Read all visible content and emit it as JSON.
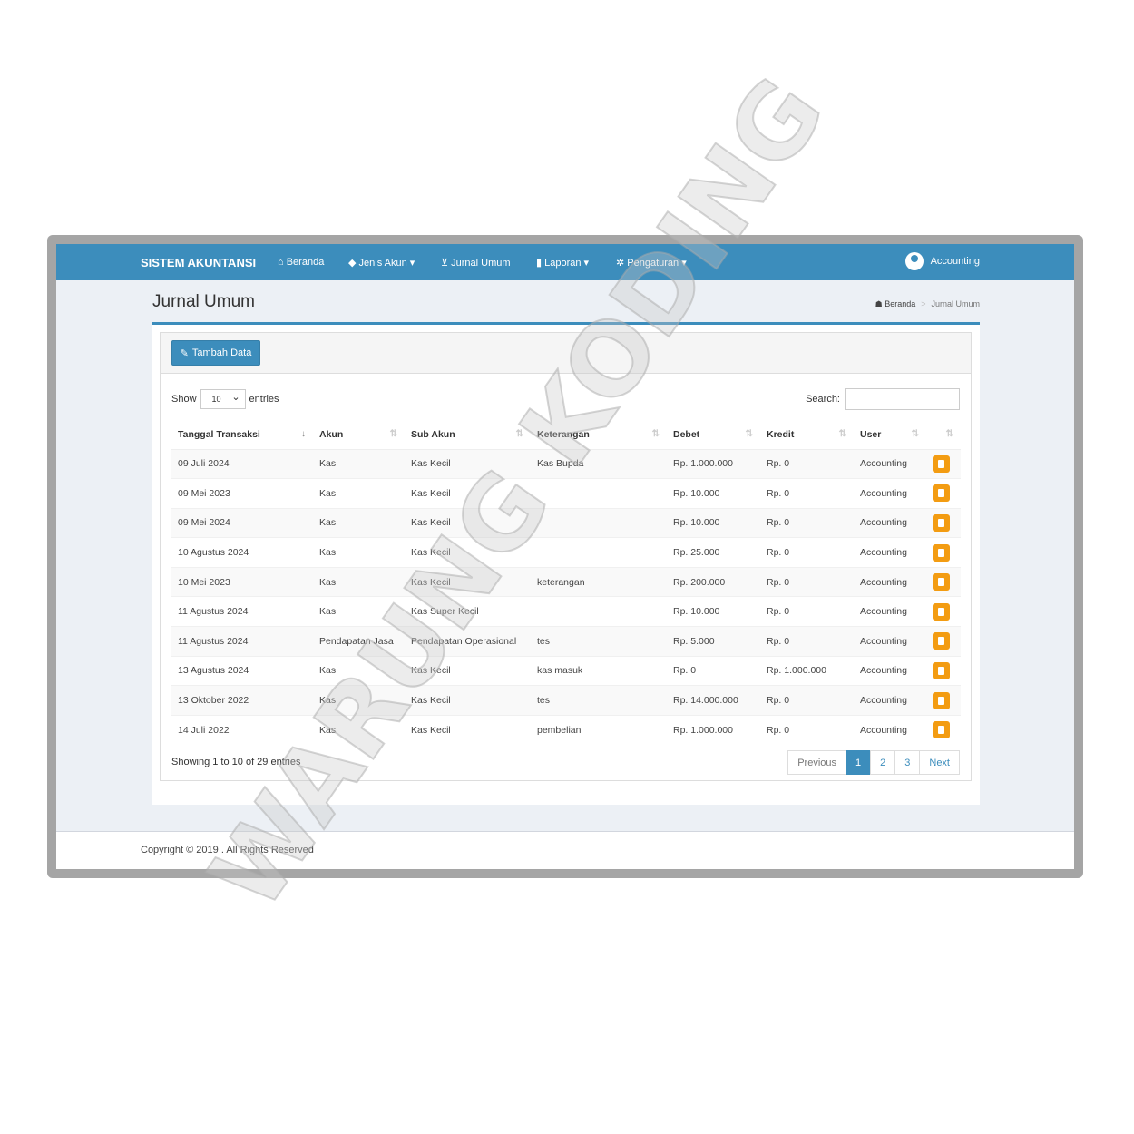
{
  "navbar": {
    "brand": "SISTEM AKUNTANSI",
    "items": [
      {
        "label": "Beranda",
        "icon": "home-icon"
      },
      {
        "label": "Jenis Akun ▾",
        "icon": "tag-icon"
      },
      {
        "label": "Jurnal Umum",
        "icon": "cart-icon"
      },
      {
        "label": "Laporan ▾",
        "icon": "file-icon"
      },
      {
        "label": "Pengaturan ▾",
        "icon": "gear-icon"
      }
    ],
    "user": "Accounting"
  },
  "page": {
    "title": "Jurnal Umum",
    "breadcrumb": [
      "Beranda",
      "Jurnal Umum"
    ]
  },
  "toolbar": {
    "add_label": "Tambah Data"
  },
  "table_controls": {
    "show": "Show",
    "entries_value": "10",
    "entries": "entries",
    "search_label": "Search:"
  },
  "table": {
    "columns": [
      "Tanggal Transaksi",
      "Akun",
      "Sub Akun",
      "Keterangan",
      "Debet",
      "Kredit",
      "User",
      ""
    ],
    "rows": [
      [
        "09 Juli 2024",
        "Kas",
        "Kas Kecil",
        "Kas Bupda",
        "Rp. 1.000.000",
        "Rp. 0",
        "Accounting"
      ],
      [
        "09 Mei 2023",
        "Kas",
        "Kas Kecil",
        "",
        "Rp. 10.000",
        "Rp. 0",
        "Accounting"
      ],
      [
        "09 Mei 2024",
        "Kas",
        "Kas Kecil",
        "",
        "Rp. 10.000",
        "Rp. 0",
        "Accounting"
      ],
      [
        "10 Agustus 2024",
        "Kas",
        "Kas Kecil",
        "",
        "Rp. 25.000",
        "Rp. 0",
        "Accounting"
      ],
      [
        "10 Mei 2023",
        "Kas",
        "Kas Kecil",
        "keterangan",
        "Rp. 200.000",
        "Rp. 0",
        "Accounting"
      ],
      [
        "11 Agustus 2024",
        "Kas",
        "Kas Super Kecil",
        "",
        "Rp. 10.000",
        "Rp. 0",
        "Accounting"
      ],
      [
        "11 Agustus 2024",
        "Pendapatan Jasa",
        "Pendapatan Operasional",
        "tes",
        "Rp. 5.000",
        "Rp. 0",
        "Accounting"
      ],
      [
        "13 Agustus 2024",
        "Kas",
        "Kas Kecil",
        "kas masuk",
        "Rp. 0",
        "Rp. 1.000.000",
        "Accounting"
      ],
      [
        "13 Oktober 2022",
        "Kas",
        "Kas Kecil",
        "tes",
        "Rp. 14.000.000",
        "Rp. 0",
        "Accounting"
      ],
      [
        "14 Juli 2022",
        "Kas",
        "Kas Kecil",
        "pembelian",
        "Rp. 1.000.000",
        "Rp. 0",
        "Accounting"
      ]
    ]
  },
  "pagination": {
    "info": "Showing 1 to 10 of 29 entries",
    "previous": "Previous",
    "pages": [
      "1",
      "2",
      "3"
    ],
    "current": "1",
    "next": "Next"
  },
  "footer": {
    "text": "Copyright © 2019 . All Rights Reserved"
  },
  "watermark": "WARUNG KODING",
  "colors": {
    "primary": "#3c8dbc",
    "delete": "#f39c12"
  }
}
